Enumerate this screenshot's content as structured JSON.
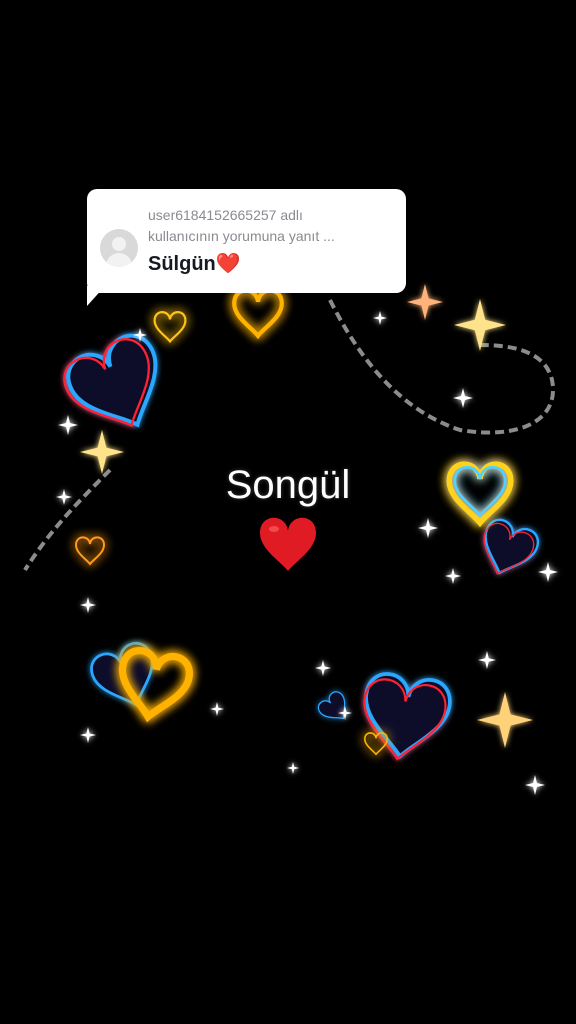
{
  "reply": {
    "line1": "user6184152665257 adlı",
    "line2": "kullanıcının yorumuna yanıt ...",
    "comment": "Sülgün❤️"
  },
  "overlay": {
    "name": "Songül"
  },
  "decor": {
    "hearts": [
      "neon-heart",
      "glow-heart",
      "red-heart"
    ],
    "chain_icon": "chain-icon",
    "sparkle_icon": "sparkle-icon"
  },
  "colors": {
    "background": "#000000",
    "card": "#ffffff",
    "heart_red": "#e01b24",
    "neon_blue": "#2aa8ff",
    "neon_gold": "#ffb300"
  }
}
